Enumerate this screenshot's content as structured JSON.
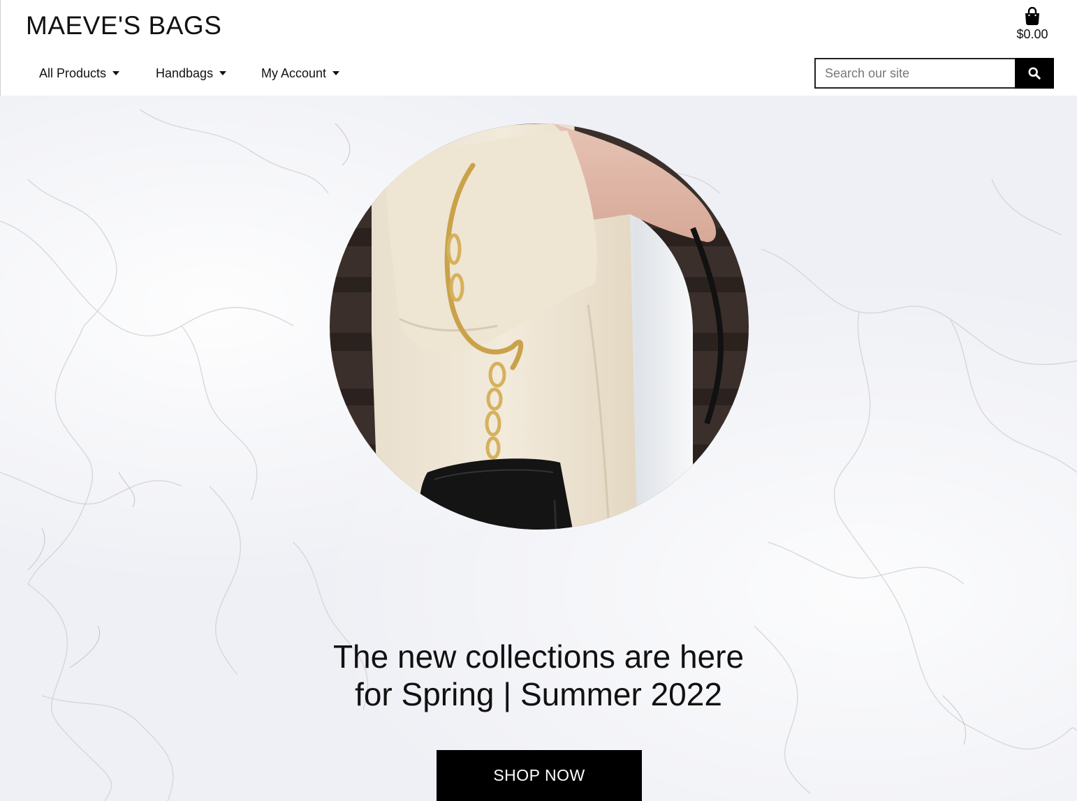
{
  "header": {
    "logo_text": "MAEVE'S BAGS",
    "cart": {
      "icon": "shopping-bag-icon",
      "total": "$0.00"
    }
  },
  "nav": {
    "items": [
      {
        "label": "All Products",
        "icon": "caret-down-icon"
      },
      {
        "label": "Handbags",
        "icon": "caret-down-icon"
      },
      {
        "label": "My Account",
        "icon": "caret-down-icon"
      }
    ]
  },
  "search": {
    "placeholder": "Search our site",
    "value": "",
    "button_icon": "search-icon"
  },
  "hero": {
    "headline_line1": "The new collections are here",
    "headline_line2": "for Spring | Summer 2022",
    "cta_label": "SHOP NOW"
  },
  "colors": {
    "primary": "#000000",
    "background": "#ffffff",
    "hero_bg": "#eff0f5",
    "text": "#111111"
  }
}
